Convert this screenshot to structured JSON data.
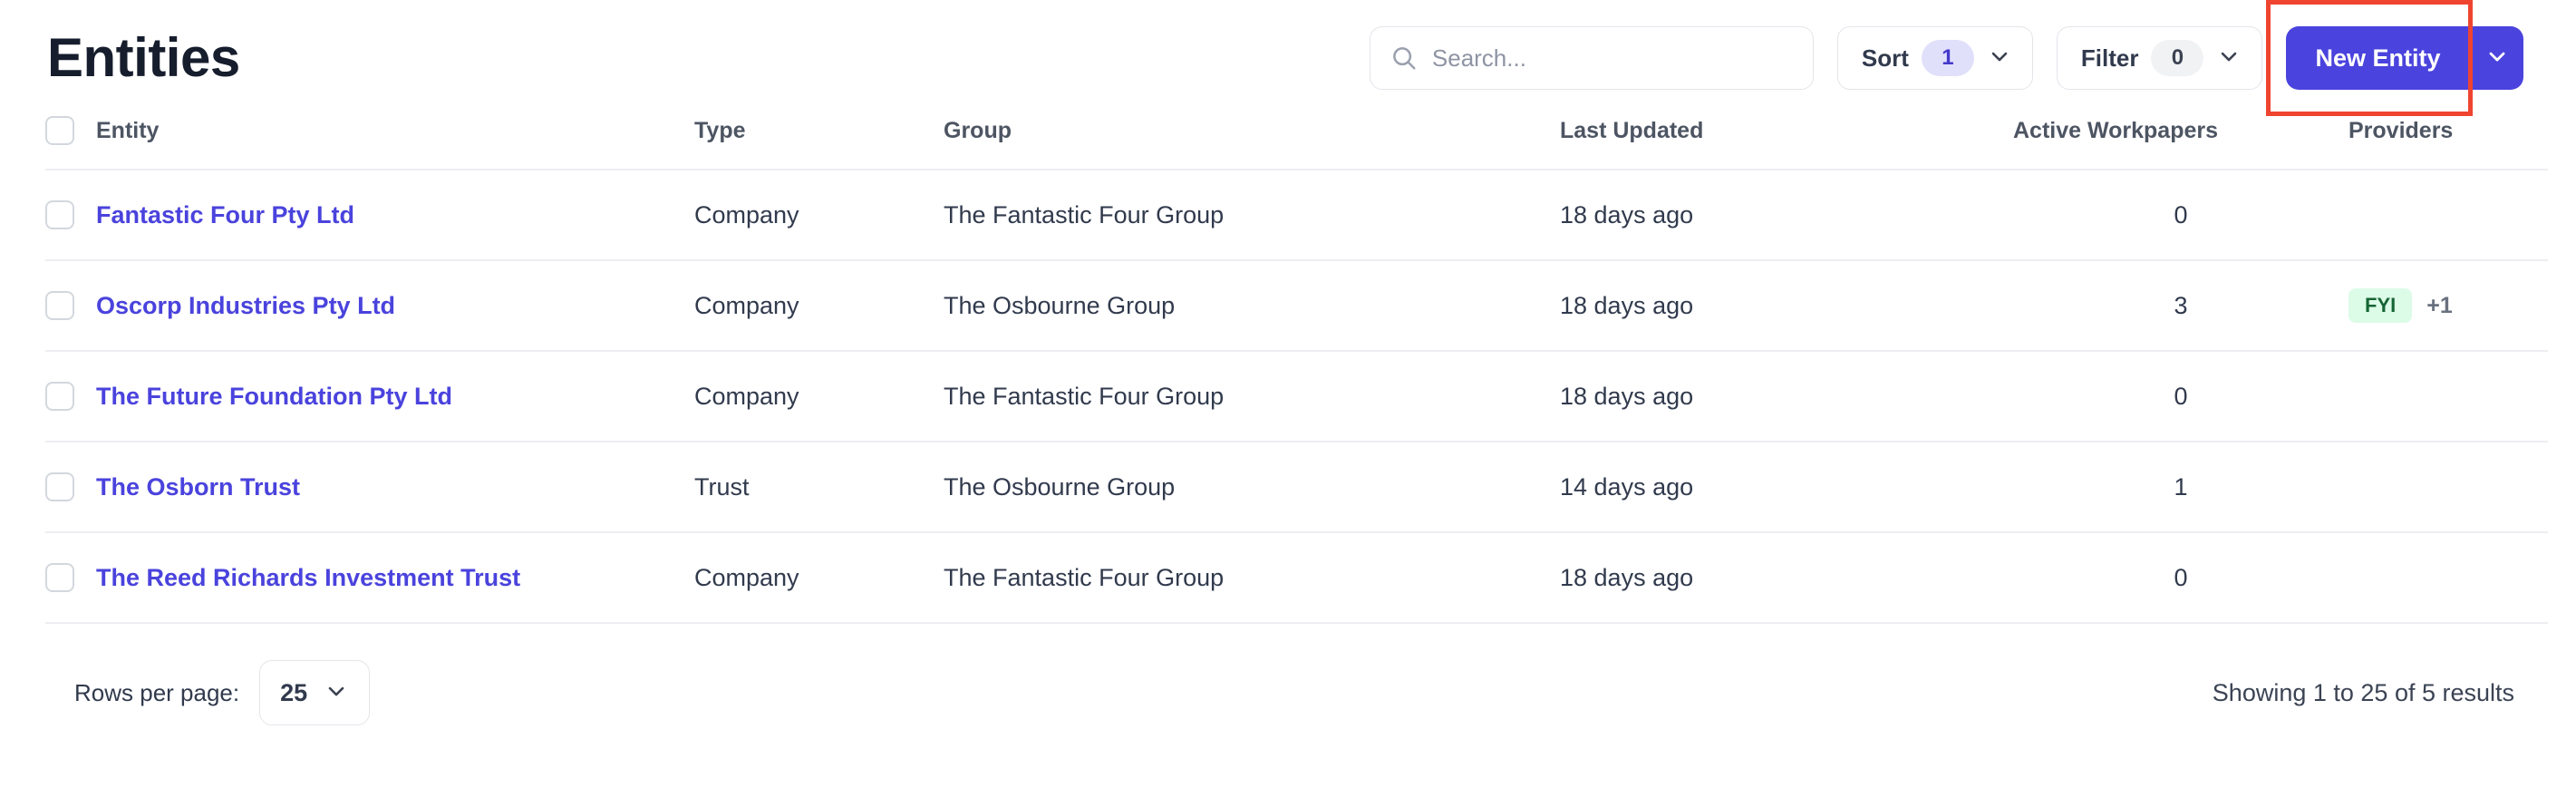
{
  "header": {
    "title": "Entities"
  },
  "search": {
    "placeholder": "Search...",
    "value": "",
    "icon": "search-icon"
  },
  "toolbar": {
    "sort": {
      "label": "Sort",
      "count": "1",
      "icon": "chevron-down-icon"
    },
    "filter": {
      "label": "Filter",
      "count": "0",
      "icon": "chevron-down-icon"
    },
    "new_entity": {
      "label": "New Entity",
      "caret_icon": "chevron-down-icon"
    }
  },
  "colors": {
    "accent": "#4a43dd",
    "accent_badge_bg": "#e0e0fb",
    "highlight": "#ef4430",
    "provider_badge_bg": "#dcfce7",
    "provider_badge_text": "#166534",
    "title": "#161d2d"
  },
  "table": {
    "columns": [
      "Entity",
      "Type",
      "Group",
      "Last Updated",
      "Active Workpapers",
      "Providers"
    ],
    "rows": [
      {
        "entity": "Fantastic Four Pty Ltd",
        "type": "Company",
        "group": "The Fantastic Four Group",
        "last_updated": "18 days ago",
        "active_workpapers": "0",
        "providers": [],
        "providers_more": ""
      },
      {
        "entity": "Oscorp Industries Pty Ltd",
        "type": "Company",
        "group": "The Osbourne Group",
        "last_updated": "18 days ago",
        "active_workpapers": "3",
        "providers": [
          "FYI"
        ],
        "providers_more": "+1"
      },
      {
        "entity": "The Future Foundation Pty Ltd",
        "type": "Company",
        "group": "The Fantastic Four Group",
        "last_updated": "18 days ago",
        "active_workpapers": "0",
        "providers": [],
        "providers_more": ""
      },
      {
        "entity": "The Osborn Trust",
        "type": "Trust",
        "group": "The Osbourne Group",
        "last_updated": "14 days ago",
        "active_workpapers": "1",
        "providers": [],
        "providers_more": ""
      },
      {
        "entity": "The Reed Richards Investment Trust",
        "type": "Company",
        "group": "The Fantastic Four Group",
        "last_updated": "18 days ago",
        "active_workpapers": "0",
        "providers": [],
        "providers_more": ""
      }
    ]
  },
  "footer": {
    "rows_per_page_label": "Rows per page:",
    "rows_per_page_value": "25",
    "rows_per_page_icon": "chevron-down-icon",
    "results_text": "Showing 1 to 25 of 5 results"
  }
}
